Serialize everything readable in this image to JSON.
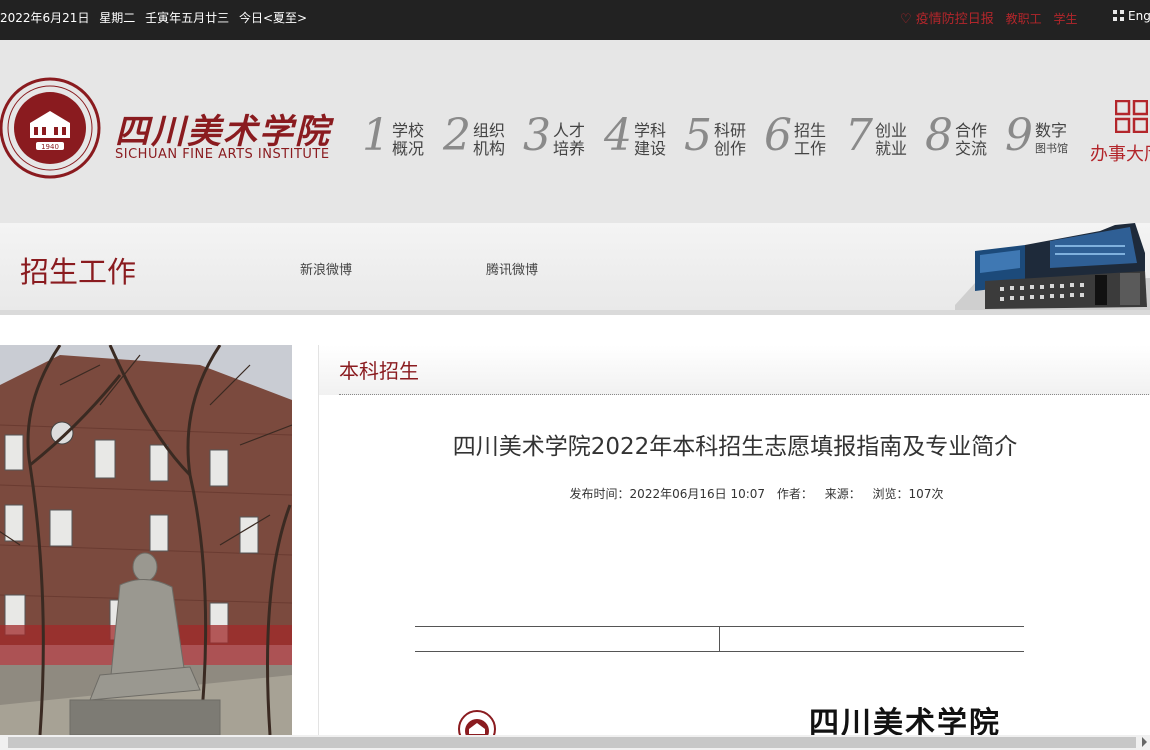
{
  "topbar": {
    "date": "2022年6月21日",
    "weekday": "星期二",
    "lunar": "壬寅年五月廿三",
    "term": "今日<夏至>",
    "links": [
      {
        "label": "♡ 疫情防控日报"
      },
      {
        "label": "教职工"
      },
      {
        "label": "学生"
      }
    ],
    "lang": "Eng"
  },
  "header": {
    "logo_cn": "四川美术学院",
    "logo_en": "SICHUAN FINE ARTS INSTITUTE",
    "seal_year": "1940",
    "nav": [
      {
        "num": "1",
        "line1": "学校",
        "line2": "概况"
      },
      {
        "num": "2",
        "line1": "组织",
        "line2": "机构"
      },
      {
        "num": "3",
        "line1": "人才",
        "line2": "培养"
      },
      {
        "num": "4",
        "line1": "学科",
        "line2": "建设"
      },
      {
        "num": "5",
        "line1": "科研",
        "line2": "创作"
      },
      {
        "num": "6",
        "line1": "招生",
        "line2": "工作"
      },
      {
        "num": "7",
        "line1": "创业",
        "line2": "就业"
      },
      {
        "num": "8",
        "line1": "合作",
        "line2": "交流"
      },
      {
        "num": "9",
        "line1": "数字",
        "line2": "图书馆"
      }
    ],
    "office_label": "办事大厅"
  },
  "band": {
    "title": "招生工作",
    "weibo": [
      "新浪微博",
      "腾讯微博"
    ]
  },
  "article": {
    "category": "本科招生",
    "title": "四川美术学院2022年本科招生志愿填报指南及专业简介",
    "meta": {
      "published": "发布时间：2022年06月16日 10:07",
      "author": "作者：",
      "source": "来源：",
      "views": "浏览：107次"
    },
    "doc_school": "四川美术学院"
  },
  "colors": {
    "brand": "#8a1b1f",
    "topbar_bg": "#222222",
    "header_bg": "#e6e6e6",
    "accent_red": "#b3262b"
  }
}
